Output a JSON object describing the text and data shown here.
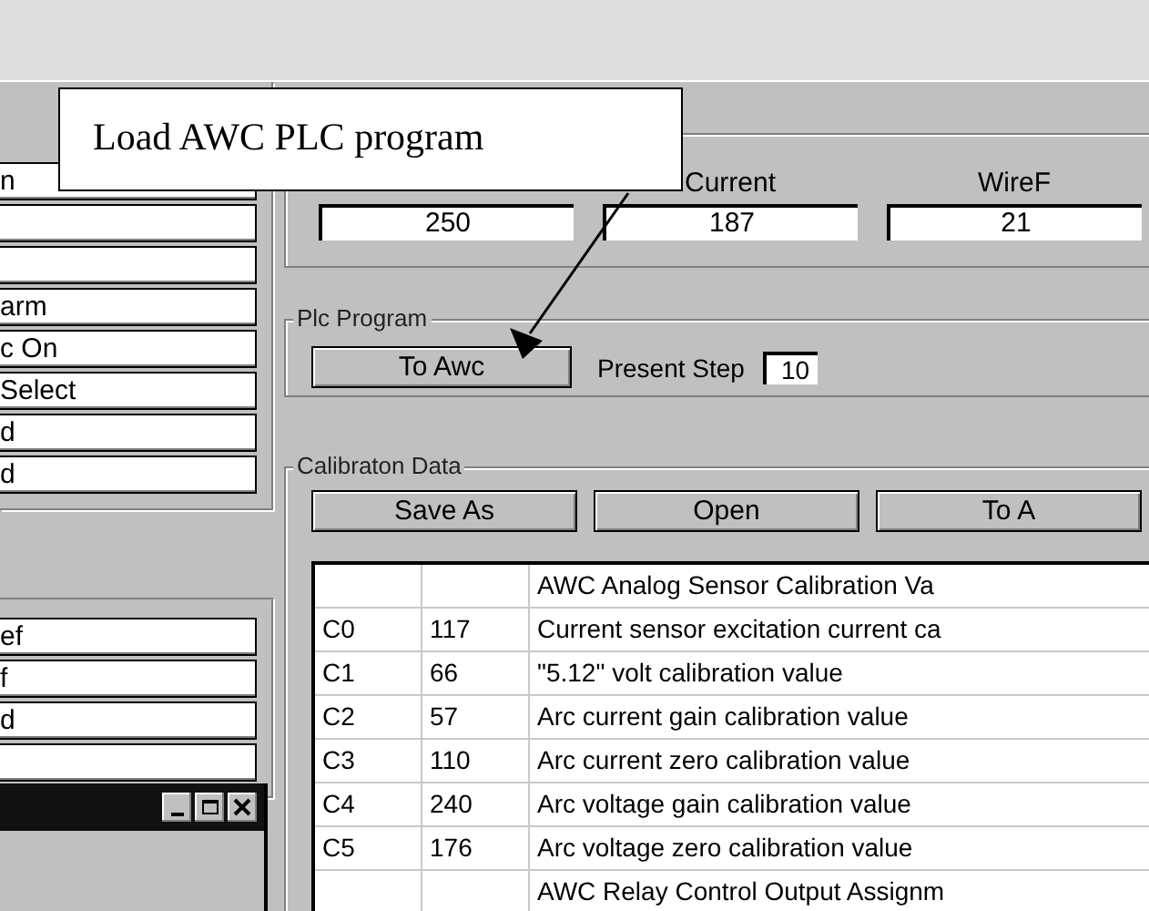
{
  "callout": {
    "text": "Load AWC PLC program"
  },
  "left_groups": [
    {
      "fields": [
        {
          "kind": "text",
          "value": "n"
        },
        {
          "kind": "empty"
        },
        {
          "kind": "empty"
        },
        {
          "kind": "text",
          "value": "arm"
        },
        {
          "kind": "text",
          "value": "c On"
        },
        {
          "kind": "text",
          "value": "Select"
        },
        {
          "kind": "text",
          "value": "d"
        },
        {
          "kind": "text",
          "value": "d"
        }
      ]
    },
    {
      "fields": [
        {
          "kind": "text",
          "value": "ef"
        },
        {
          "kind": "text",
          "value": "f"
        },
        {
          "kind": "text",
          "value": "d"
        },
        {
          "kind": "empty"
        }
      ]
    }
  ],
  "readings": [
    {
      "value": "250"
    },
    {
      "label": "Current",
      "value": "187"
    },
    {
      "label": "WireF",
      "value": "21"
    }
  ],
  "plc_program": {
    "legend": "Plc Program",
    "button": "To Awc",
    "step_label": "Present Step",
    "step_value": "10"
  },
  "calibration": {
    "legend": "Calibraton Data",
    "buttons": [
      "Save As",
      "Open",
      "To A"
    ],
    "rows": [
      {
        "kind": "section",
        "title": "AWC Analog Sensor Calibration Va"
      },
      {
        "kind": "data",
        "code": "C0",
        "value": "117",
        "description": "Current sensor excitation current ca"
      },
      {
        "kind": "data",
        "code": "C1",
        "value": "66",
        "description": "\"5.12\" volt calibration value"
      },
      {
        "kind": "data",
        "code": "C2",
        "value": "57",
        "description": "Arc current gain calibration value"
      },
      {
        "kind": "data",
        "code": "C3",
        "value": "110",
        "description": "Arc current zero calibration value"
      },
      {
        "kind": "data",
        "code": "C4",
        "value": "240",
        "description": "Arc voltage gain calibration value"
      },
      {
        "kind": "data",
        "code": "C5",
        "value": "176",
        "description": "Arc voltage zero calibration value"
      },
      {
        "kind": "section",
        "title": "AWC Relay Control Output Assignm"
      }
    ]
  }
}
